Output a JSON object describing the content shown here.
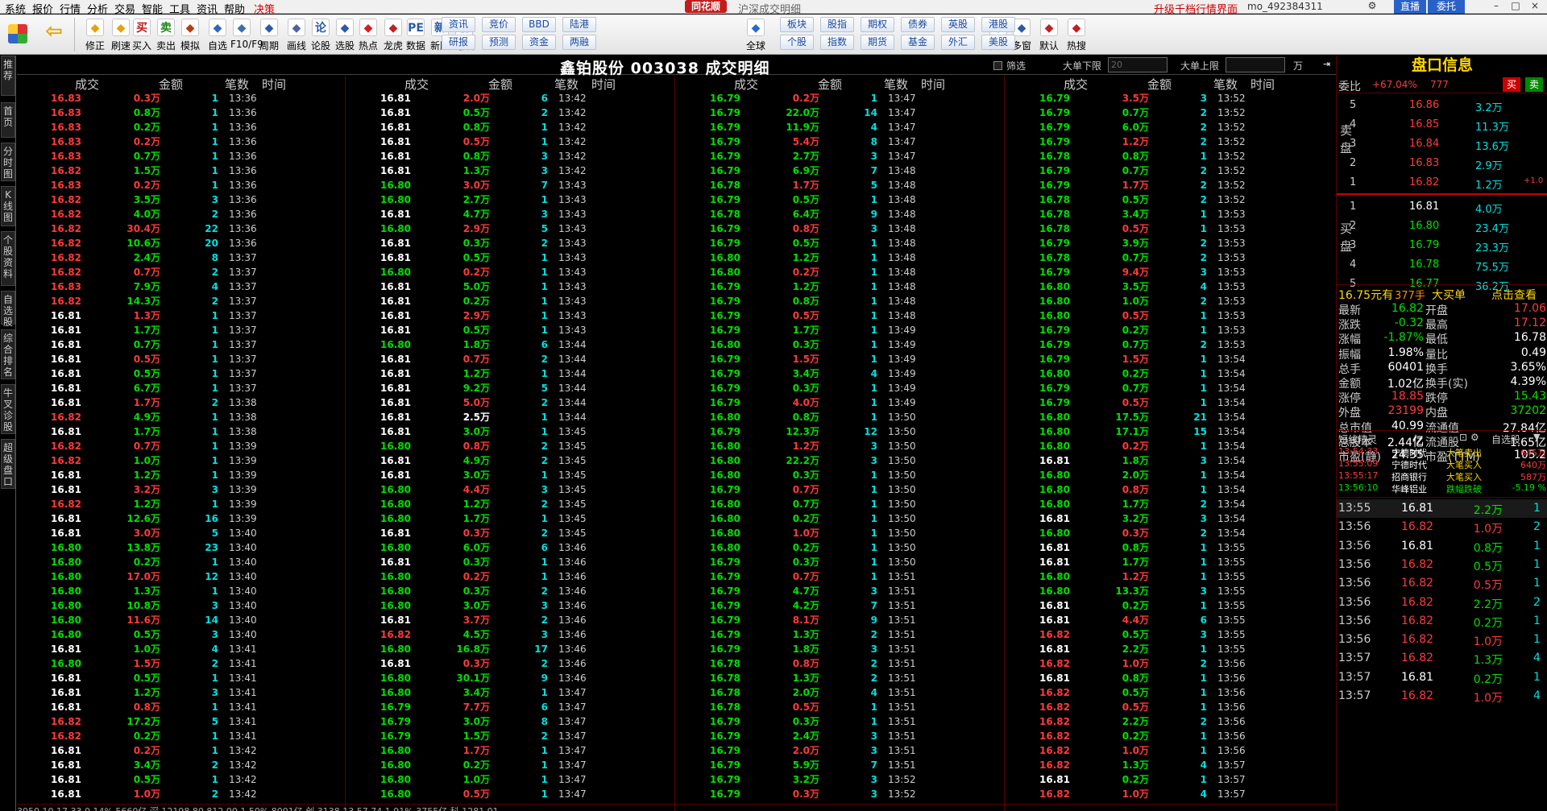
{
  "menu": {
    "items": [
      "系统",
      "报价",
      "行情",
      "分析",
      "交易",
      "智能",
      "工具",
      "资讯",
      "帮助",
      "决策"
    ],
    "logo": "同花顺",
    "path": "沪深成交明细",
    "upgrade": "升级千档行情界面",
    "user": "mo_492384311",
    "btn_direct": "直播",
    "btn_entrust": "委托",
    "btn_min": "–",
    "btn_max": "□",
    "btn_close": "×"
  },
  "toolbar": {
    "buttons": [
      {
        "label": "修正",
        "icon": "up-down-arrow-icon"
      },
      {
        "label": "刷速",
        "icon": "refresh-icon"
      },
      {
        "label": "买入",
        "icon": "buy-icon",
        "text": "买"
      },
      {
        "label": "卖出",
        "icon": "sell-icon",
        "text": "卖"
      },
      {
        "label": "模拟",
        "icon": "hammer-icon"
      },
      {
        "label": "自选",
        "icon": "star-icon"
      },
      {
        "label": "F10/F9",
        "icon": "document-icon"
      },
      {
        "label": "周期",
        "icon": "clock-icon"
      },
      {
        "label": "画线",
        "icon": "pencil-icon"
      },
      {
        "label": "论股",
        "icon": "chat-icon",
        "text": "论"
      },
      {
        "label": "选股",
        "icon": "filter-icon"
      },
      {
        "label": "热点",
        "icon": "fire-icon"
      },
      {
        "label": "龙虎",
        "icon": "dragon-icon"
      },
      {
        "label": "数据",
        "icon": "pe-icon",
        "text": "PE"
      },
      {
        "label": "新股",
        "icon": "new-stock-icon",
        "text": "新"
      },
      {
        "label": "创/科",
        "icon": "innovation-icon",
        "text": "创"
      },
      {
        "label": "全球",
        "icon": "globe-icon"
      },
      {
        "label": "自定",
        "icon": "grid-icon"
      },
      {
        "label": "多窗",
        "icon": "multiwindow-icon"
      },
      {
        "label": "默认",
        "icon": "home-icon"
      },
      {
        "label": "热搜",
        "icon": "hot-search-icon"
      }
    ],
    "squares": [
      [
        "资讯",
        "研报"
      ],
      [
        "竞价",
        "预测"
      ],
      [
        "BBD",
        "资金"
      ],
      [
        "陆港",
        "两融"
      ],
      [
        "板块",
        "个股"
      ],
      [
        "股指",
        "指数"
      ],
      [
        "期权",
        "期货"
      ],
      [
        "债券",
        "基金"
      ],
      [
        "英股",
        "外汇"
      ],
      [
        "港股",
        "美股"
      ]
    ]
  },
  "sidebar": [
    "推荐",
    "首页",
    "分时图",
    "K线图",
    "个股资料",
    "自选股",
    "综合排名",
    "牛叉诊股",
    "超级盘口"
  ],
  "header": {
    "title": "鑫铂股份 003038 成交明细",
    "filter": "筛选",
    "big_lower": "大单下限",
    "big_lower_value": "20",
    "big_upper": "大单上限",
    "unit": "万",
    "col_headers": [
      "成交",
      "金额",
      "笔数",
      "时间"
    ]
  },
  "trades": [
    [
      "16.83",
      "0.3万",
      "1",
      "13:36",
      "16.81",
      "2.0万",
      "6",
      "13:42",
      "16.79",
      "0.2万",
      "1",
      "13:47",
      "16.79",
      "3.5万",
      "3",
      "13:52"
    ],
    [
      "16.83",
      "0.8万",
      "1",
      "13:36",
      "16.81",
      "0.5万",
      "2",
      "13:42",
      "16.79",
      "22.0万",
      "14",
      "13:47",
      "16.79",
      "0.7万",
      "2",
      "13:52"
    ],
    [
      "16.83",
      "0.2万",
      "1",
      "13:36",
      "16.81",
      "0.8万",
      "1",
      "13:42",
      "16.79",
      "11.9万",
      "4",
      "13:47",
      "16.79",
      "6.0万",
      "2",
      "13:52"
    ],
    [
      "16.83",
      "0.2万",
      "1",
      "13:36",
      "16.81",
      "0.5万",
      "1",
      "13:42",
      "16.79",
      "5.4万",
      "8",
      "13:47",
      "16.79",
      "1.2万",
      "2",
      "13:52"
    ],
    [
      "16.83",
      "0.7万",
      "1",
      "13:36",
      "16.81",
      "0.8万",
      "3",
      "13:42",
      "16.79",
      "2.7万",
      "3",
      "13:47",
      "16.78",
      "0.8万",
      "1",
      "13:52"
    ],
    [
      "16.82",
      "1.5万",
      "1",
      "13:36",
      "16.81",
      "1.3万",
      "3",
      "13:42",
      "16.79",
      "6.9万",
      "7",
      "13:48",
      "16.79",
      "0.7万",
      "2",
      "13:52"
    ],
    [
      "16.83",
      "0.2万",
      "1",
      "13:36",
      "16.80",
      "3.0万",
      "7",
      "13:43",
      "16.78",
      "1.7万",
      "5",
      "13:48",
      "16.79",
      "1.7万",
      "2",
      "13:52"
    ],
    [
      "16.82",
      "3.5万",
      "3",
      "13:36",
      "16.80",
      "2.7万",
      "1",
      "13:43",
      "16.79",
      "0.5万",
      "1",
      "13:48",
      "16.78",
      "0.5万",
      "2",
      "13:52"
    ],
    [
      "16.82",
      "4.0万",
      "2",
      "13:36",
      "16.81",
      "4.7万",
      "3",
      "13:43",
      "16.78",
      "6.4万",
      "9",
      "13:48",
      "16.78",
      "3.4万",
      "1",
      "13:53"
    ],
    [
      "16.82",
      "30.4万",
      "22",
      "13:36",
      "16.80",
      "2.9万",
      "5",
      "13:43",
      "16.79",
      "0.8万",
      "3",
      "13:48",
      "16.78",
      "0.5万",
      "1",
      "13:53"
    ],
    [
      "16.82",
      "10.6万",
      "20",
      "13:36",
      "16.81",
      "0.3万",
      "2",
      "13:43",
      "16.79",
      "0.5万",
      "1",
      "13:48",
      "16.79",
      "3.9万",
      "2",
      "13:53"
    ],
    [
      "16.82",
      "2.4万",
      "8",
      "13:37",
      "16.81",
      "0.5万",
      "1",
      "13:43",
      "16.80",
      "1.2万",
      "1",
      "13:48",
      "16.78",
      "0.7万",
      "2",
      "13:53"
    ],
    [
      "16.82",
      "0.7万",
      "2",
      "13:37",
      "16.80",
      "0.2万",
      "1",
      "13:43",
      "16.80",
      "0.2万",
      "1",
      "13:48",
      "16.79",
      "9.4万",
      "3",
      "13:53"
    ],
    [
      "16.83",
      "7.9万",
      "4",
      "13:37",
      "16.81",
      "5.0万",
      "1",
      "13:43",
      "16.79",
      "1.2万",
      "1",
      "13:48",
      "16.80",
      "3.5万",
      "4",
      "13:53"
    ],
    [
      "16.82",
      "14.3万",
      "2",
      "13:37",
      "16.81",
      "0.2万",
      "1",
      "13:43",
      "16.79",
      "0.8万",
      "1",
      "13:48",
      "16.80",
      "1.0万",
      "2",
      "13:53"
    ],
    [
      "16.81",
      "1.3万",
      "1",
      "13:37",
      "16.81",
      "2.9万",
      "1",
      "13:43",
      "16.79",
      "0.5万",
      "1",
      "13:48",
      "16.80",
      "0.5万",
      "1",
      "13:53"
    ],
    [
      "16.81",
      "1.7万",
      "1",
      "13:37",
      "16.81",
      "0.5万",
      "1",
      "13:43",
      "16.79",
      "1.7万",
      "1",
      "13:49",
      "16.79",
      "0.2万",
      "1",
      "13:53"
    ],
    [
      "16.81",
      "0.7万",
      "1",
      "13:37",
      "16.80",
      "1.8万",
      "6",
      "13:44",
      "16.80",
      "0.3万",
      "1",
      "13:49",
      "16.79",
      "0.7万",
      "2",
      "13:53"
    ],
    [
      "16.81",
      "0.5万",
      "1",
      "13:37",
      "16.81",
      "0.7万",
      "2",
      "13:44",
      "16.79",
      "1.5万",
      "1",
      "13:49",
      "16.79",
      "1.5万",
      "1",
      "13:54"
    ],
    [
      "16.81",
      "0.5万",
      "1",
      "13:37",
      "16.81",
      "1.2万",
      "1",
      "13:44",
      "16.79",
      "3.4万",
      "4",
      "13:49",
      "16.80",
      "0.2万",
      "1",
      "13:54"
    ],
    [
      "16.81",
      "6.7万",
      "1",
      "13:37",
      "16.81",
      "9.2万",
      "5",
      "13:44",
      "16.79",
      "0.3万",
      "1",
      "13:49",
      "16.79",
      "0.7万",
      "1",
      "13:54"
    ],
    [
      "16.81",
      "1.7万",
      "2",
      "13:38",
      "16.81",
      "5.0万",
      "2",
      "13:44",
      "16.79",
      "4.0万",
      "1",
      "13:49",
      "16.79",
      "0.5万",
      "1",
      "13:54"
    ],
    [
      "16.82",
      "4.9万",
      "1",
      "13:38",
      "16.81",
      "2.5万",
      "1",
      "13:44",
      "16.80",
      "0.8万",
      "1",
      "13:50",
      "16.80",
      "17.5万",
      "21",
      "13:54"
    ],
    [
      "16.81",
      "1.7万",
      "1",
      "13:38",
      "16.81",
      "3.0万",
      "1",
      "13:45",
      "16.79",
      "12.3万",
      "12",
      "13:50",
      "16.80",
      "17.1万",
      "15",
      "13:54"
    ],
    [
      "16.82",
      "0.7万",
      "1",
      "13:39",
      "16.80",
      "0.8万",
      "2",
      "13:45",
      "16.80",
      "1.2万",
      "3",
      "13:50",
      "16.80",
      "0.2万",
      "1",
      "13:54"
    ],
    [
      "16.82",
      "1.0万",
      "1",
      "13:39",
      "16.81",
      "4.9万",
      "2",
      "13:45",
      "16.80",
      "22.2万",
      "3",
      "13:50",
      "16.81",
      "1.8万",
      "3",
      "13:54"
    ],
    [
      "16.81",
      "1.2万",
      "1",
      "13:39",
      "16.81",
      "3.0万",
      "1",
      "13:45",
      "16.80",
      "0.3万",
      "1",
      "13:50",
      "16.80",
      "2.0万",
      "1",
      "13:54"
    ],
    [
      "16.81",
      "3.2万",
      "3",
      "13:39",
      "16.80",
      "4.4万",
      "3",
      "13:45",
      "16.79",
      "0.7万",
      "1",
      "13:50",
      "16.80",
      "0.8万",
      "1",
      "13:54"
    ],
    [
      "16.82",
      "1.2万",
      "1",
      "13:39",
      "16.80",
      "1.2万",
      "2",
      "13:45",
      "16.80",
      "0.7万",
      "1",
      "13:50",
      "16.80",
      "1.7万",
      "2",
      "13:54"
    ],
    [
      "16.81",
      "12.6万",
      "16",
      "13:39",
      "16.80",
      "1.7万",
      "1",
      "13:45",
      "16.80",
      "0.2万",
      "1",
      "13:50",
      "16.81",
      "3.2万",
      "3",
      "13:54"
    ],
    [
      "16.81",
      "3.0万",
      "5",
      "13:40",
      "16.81",
      "0.3万",
      "2",
      "13:45",
      "16.80",
      "1.0万",
      "1",
      "13:50",
      "16.80",
      "0.3万",
      "2",
      "13:54"
    ],
    [
      "16.80",
      "13.8万",
      "23",
      "13:40",
      "16.80",
      "6.0万",
      "6",
      "13:46",
      "16.80",
      "0.2万",
      "1",
      "13:50",
      "16.81",
      "0.8万",
      "1",
      "13:55"
    ],
    [
      "16.80",
      "0.2万",
      "1",
      "13:40",
      "16.81",
      "0.3万",
      "1",
      "13:46",
      "16.79",
      "0.3万",
      "1",
      "13:50",
      "16.81",
      "1.7万",
      "1",
      "13:55"
    ],
    [
      "16.80",
      "17.0万",
      "12",
      "13:40",
      "16.80",
      "0.2万",
      "1",
      "13:46",
      "16.79",
      "0.7万",
      "1",
      "13:51",
      "16.80",
      "1.2万",
      "1",
      "13:55"
    ],
    [
      "16.80",
      "1.3万",
      "1",
      "13:40",
      "16.80",
      "0.3万",
      "2",
      "13:46",
      "16.79",
      "4.7万",
      "3",
      "13:51",
      "16.80",
      "13.3万",
      "3",
      "13:55"
    ],
    [
      "16.80",
      "10.8万",
      "3",
      "13:40",
      "16.80",
      "3.0万",
      "3",
      "13:46",
      "16.79",
      "4.2万",
      "7",
      "13:51",
      "16.81",
      "0.2万",
      "1",
      "13:55"
    ],
    [
      "16.80",
      "11.6万",
      "14",
      "13:40",
      "16.81",
      "3.7万",
      "2",
      "13:46",
      "16.79",
      "8.1万",
      "9",
      "13:51",
      "16.81",
      "4.4万",
      "6",
      "13:55"
    ],
    [
      "16.80",
      "0.5万",
      "3",
      "13:40",
      "16.82",
      "4.5万",
      "3",
      "13:46",
      "16.79",
      "1.3万",
      "2",
      "13:51",
      "16.82",
      "0.5万",
      "3",
      "13:55"
    ],
    [
      "16.81",
      "1.0万",
      "4",
      "13:41",
      "16.80",
      "16.8万",
      "17",
      "13:46",
      "16.79",
      "1.8万",
      "3",
      "13:51",
      "16.81",
      "2.2万",
      "1",
      "13:55"
    ],
    [
      "16.80",
      "1.5万",
      "2",
      "13:41",
      "16.81",
      "0.3万",
      "2",
      "13:46",
      "16.78",
      "0.8万",
      "2",
      "13:51",
      "16.82",
      "1.0万",
      "2",
      "13:56"
    ],
    [
      "16.81",
      "0.5万",
      "1",
      "13:41",
      "16.80",
      "30.1万",
      "9",
      "13:46",
      "16.78",
      "1.3万",
      "2",
      "13:51",
      "16.81",
      "0.8万",
      "1",
      "13:56"
    ],
    [
      "16.81",
      "1.2万",
      "3",
      "13:41",
      "16.80",
      "3.4万",
      "1",
      "13:47",
      "16.78",
      "2.0万",
      "4",
      "13:51",
      "16.82",
      "0.5万",
      "1",
      "13:56"
    ],
    [
      "16.81",
      "0.8万",
      "1",
      "13:41",
      "16.79",
      "7.7万",
      "6",
      "13:47",
      "16.78",
      "0.5万",
      "1",
      "13:51",
      "16.82",
      "0.5万",
      "1",
      "13:56"
    ],
    [
      "16.82",
      "17.2万",
      "5",
      "13:41",
      "16.79",
      "3.0万",
      "8",
      "13:47",
      "16.79",
      "0.3万",
      "1",
      "13:51",
      "16.82",
      "2.2万",
      "2",
      "13:56"
    ],
    [
      "16.82",
      "0.2万",
      "1",
      "13:41",
      "16.79",
      "1.5万",
      "2",
      "13:47",
      "16.79",
      "2.4万",
      "3",
      "13:51",
      "16.82",
      "0.2万",
      "1",
      "13:56"
    ],
    [
      "16.81",
      "0.2万",
      "1",
      "13:42",
      "16.80",
      "1.7万",
      "1",
      "13:47",
      "16.79",
      "2.0万",
      "3",
      "13:51",
      "16.82",
      "1.0万",
      "1",
      "13:56"
    ],
    [
      "16.81",
      "3.4万",
      "2",
      "13:42",
      "16.80",
      "0.2万",
      "1",
      "13:47",
      "16.79",
      "5.9万",
      "7",
      "13:51",
      "16.82",
      "1.3万",
      "4",
      "13:57"
    ],
    [
      "16.81",
      "0.5万",
      "1",
      "13:42",
      "16.80",
      "1.0万",
      "1",
      "13:47",
      "16.79",
      "3.2万",
      "3",
      "13:52",
      "16.81",
      "0.2万",
      "1",
      "13:57"
    ],
    [
      "16.81",
      "1.0万",
      "2",
      "13:42",
      "16.80",
      "0.5万",
      "1",
      "13:47",
      "16.79",
      "0.3万",
      "3",
      "13:52",
      "16.82",
      "1.0万",
      "4",
      "13:57"
    ]
  ],
  "bottom_strip": "3050.10   17.33   0.14%   5660亿   深  12198.80   812.00   1.50%   8001亿   创  3138.13   57.74   1.91%   3755亿   科  1281.01   ...",
  "panel": {
    "title": "盘口信息",
    "wb_label": "委比",
    "wb_value": "+67.04%",
    "wb_diff": "777",
    "buy": "买",
    "sell": "卖",
    "sell_side": "卖盘",
    "buy_side": "买盘",
    "asks": [
      [
        "5",
        "16.86",
        "3.2万"
      ],
      [
        "4",
        "16.85",
        "11.3万"
      ],
      [
        "3",
        "16.84",
        "13.6万"
      ],
      [
        "2",
        "16.83",
        "2.9万"
      ],
      [
        "1",
        "16.82",
        "1.2万",
        "+1.0"
      ]
    ],
    "bids": [
      [
        "1",
        "16.81",
        "4.0万"
      ],
      [
        "2",
        "16.80",
        "23.4万"
      ],
      [
        "3",
        "16.79",
        "23.3万"
      ],
      [
        "4",
        "16.78",
        "75.5万"
      ],
      [
        "5",
        "16.77",
        "36.2万"
      ]
    ],
    "bigbuy": "16.75元有",
    "bigbuy_qty": "377手",
    "bigbuy_lbl": "大买单",
    "bigbuy_link": "点击查看",
    "stats": [
      [
        "最新",
        "16.82",
        "开盘",
        "17.06"
      ],
      [
        "涨跌",
        "-0.32",
        "最高",
        "17.12"
      ],
      [
        "涨幅",
        "-1.87%",
        "最低",
        "16.78"
      ],
      [
        "振幅",
        "1.98%",
        "量比",
        "0.49"
      ],
      [
        "总手",
        "60401",
        "换手",
        "3.65%"
      ],
      [
        "金额",
        "1.02亿",
        "换手(实)",
        "4.39%"
      ],
      [
        "涨停",
        "18.85",
        "跌停",
        "15.43"
      ],
      [
        "外盘",
        "23199",
        "内盘",
        "37202"
      ],
      [
        "总市值",
        "40.99亿",
        "流通值",
        "27.84亿"
      ],
      [
        "总股本",
        "2.44亿",
        "流通股",
        "1.65亿"
      ],
      [
        "市盈(静)",
        "24.35",
        "市盈(TTM)",
        "105.2"
      ]
    ],
    "sprite_title": "短线精灵",
    "watchlist": "自选股",
    "sprites": [
      [
        "13:54:33",
        "宁德时代",
        "大笔卖出",
        "645万"
      ],
      [
        "13:55:09",
        "宁德时代",
        "大笔买入",
        "640万"
      ],
      [
        "13:55:17",
        "招商银行",
        "大笔买入",
        "587万"
      ],
      [
        "13:56:10",
        "华峰铝业",
        "跌幅跌破",
        "-5.19 %"
      ]
    ],
    "flows": [
      [
        "13:55",
        "16.81",
        "2.2万",
        "1"
      ],
      [
        "13:56",
        "16.82",
        "1.0万",
        "2"
      ],
      [
        "13:56",
        "16.81",
        "0.8万",
        "1"
      ],
      [
        "13:56",
        "16.82",
        "0.5万",
        "1"
      ],
      [
        "13:56",
        "16.82",
        "0.5万",
        "1"
      ],
      [
        "13:56",
        "16.82",
        "2.2万",
        "2"
      ],
      [
        "13:56",
        "16.82",
        "0.2万",
        "1"
      ],
      [
        "13:56",
        "16.82",
        "1.0万",
        "1"
      ],
      [
        "13:57",
        "16.82",
        "1.3万",
        "4"
      ],
      [
        "13:57",
        "16.81",
        "0.2万",
        "1"
      ],
      [
        "13:57",
        "16.82",
        "1.0万",
        "4"
      ]
    ]
  },
  "colors": {
    "up": "#ff3a3a",
    "down": "#00e000",
    "neutral": "#ffffff",
    "count": "#00e0e0",
    "prev_close": "16.81"
  }
}
